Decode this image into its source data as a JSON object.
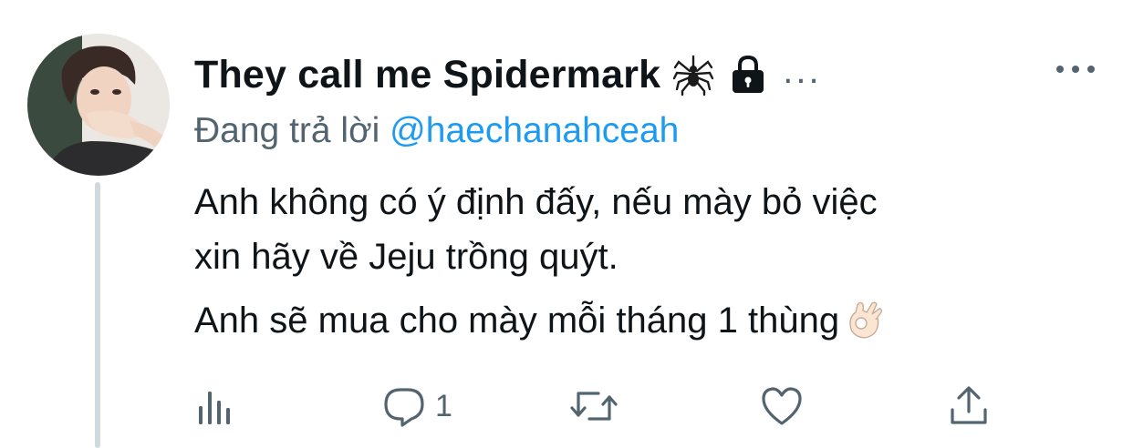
{
  "tweet": {
    "display_name": "They call me Spidermark",
    "name_emoji_icon": "spider-icon",
    "protected_icon": "lock-icon",
    "name_overflow": "...",
    "reply_prefix": "Đang trả lời",
    "reply_to": "@haechanahceah",
    "body": {
      "line1": "Anh không có ý định đấy, nếu mày bỏ việc",
      "line2": "xin hãy về Jeju trồng quýt.",
      "line3": "Anh sẽ mua cho mày mỗi tháng 1 thùng"
    },
    "body_emoji_icon": "ok-hand-icon"
  },
  "actions": {
    "analytics_icon": "analytics-icon",
    "reply_icon": "reply-bubble-icon",
    "reply_count": "1",
    "retweet_icon": "retweet-icon",
    "like_icon": "heart-icon",
    "share_icon": "share-icon"
  },
  "colors": {
    "text": "#0f1419",
    "secondary": "#536471",
    "link": "#1d9bf0",
    "thread_line": "#cfd9de"
  }
}
